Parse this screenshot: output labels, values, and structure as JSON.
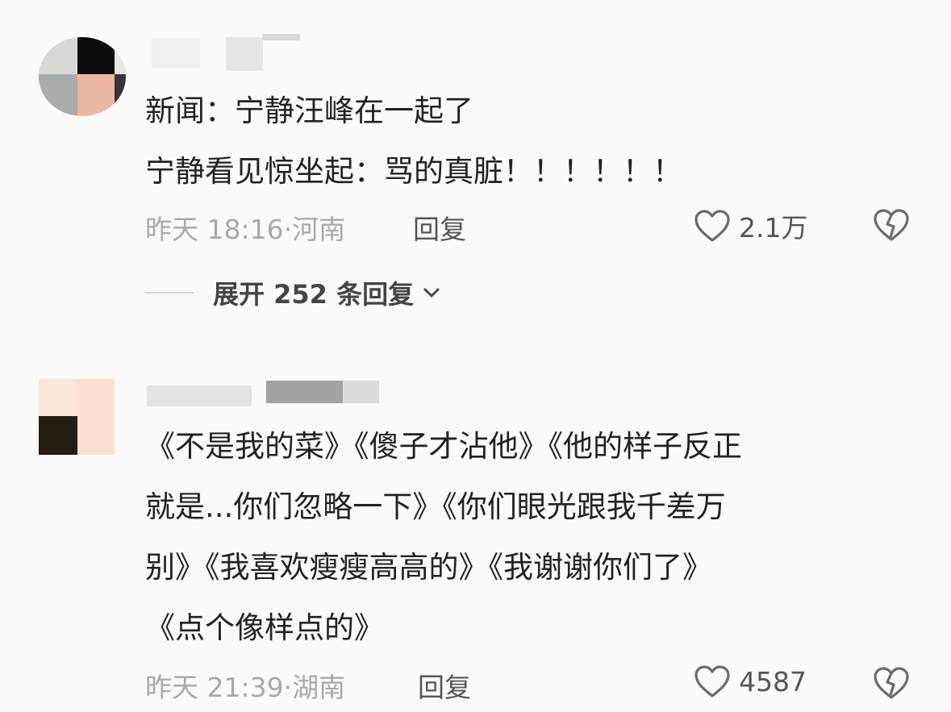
{
  "comments": [
    {
      "lines": [
        "新闻：宁静汪峰在一起了",
        "宁静看见惊坐起：骂的真脏！！！！！！"
      ],
      "time": "昨天 18:16",
      "location": "河南",
      "reply_label": "回复",
      "likes": "2.1万",
      "expand_label": "展开 252 条回复"
    },
    {
      "lines": [
        "《不是我的菜》《傻子才沾他》《他的样子反正",
        "就是...你们忽略一下》《你们眼光跟我千差万",
        "别》《我喜欢瘦瘦高高的》《我谢谢你们了》",
        "《点个像样点的》"
      ],
      "time": "昨天 21:39",
      "location": "湖南",
      "reply_label": "回复",
      "likes": "4587"
    }
  ],
  "icons": {
    "like": "heart-outline-icon",
    "dislike": "broken-heart-icon",
    "expand": "chevron-down-icon"
  },
  "colors": {
    "background": "#fafafa",
    "text": "#222222",
    "meta": "#a9a9a9",
    "action": "#555555"
  }
}
